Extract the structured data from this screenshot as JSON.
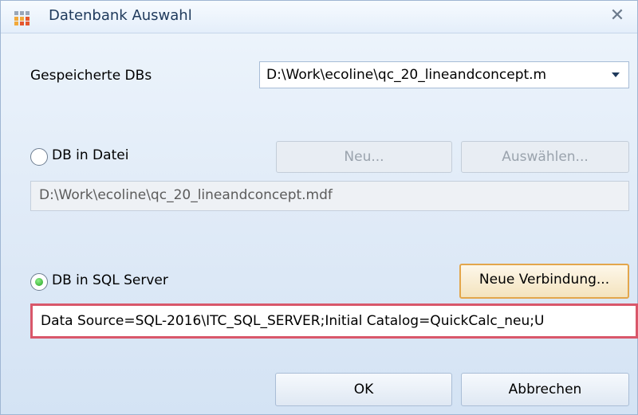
{
  "window": {
    "title": "Datenbank Auswahl",
    "close_glyph": "✕"
  },
  "saved_dbs": {
    "label": "Gespeicherte DBs",
    "selected_value": "D:\\Work\\ecoline\\qc_20_lineandconcept.m"
  },
  "file_db": {
    "radio_label": "DB in Datei",
    "new_button": "Neu...",
    "select_button": "Auswählen...",
    "path_value": "D:\\Work\\ecoline\\qc_20_lineandconcept.mdf",
    "selected": false
  },
  "sql_db": {
    "radio_label": "DB in SQL Server",
    "new_connection_button": "Neue Verbindung...",
    "connection_string": "Data Source=SQL-2016\\ITC_SQL_SERVER;Initial Catalog=QuickCalc_neu;U",
    "selected": true
  },
  "footer": {
    "ok": "OK",
    "cancel": "Abbrechen"
  },
  "colors": {
    "highlight_border": "#d9576a",
    "radio_selected": "#23a01f",
    "focus_border": "#e3a64b"
  }
}
